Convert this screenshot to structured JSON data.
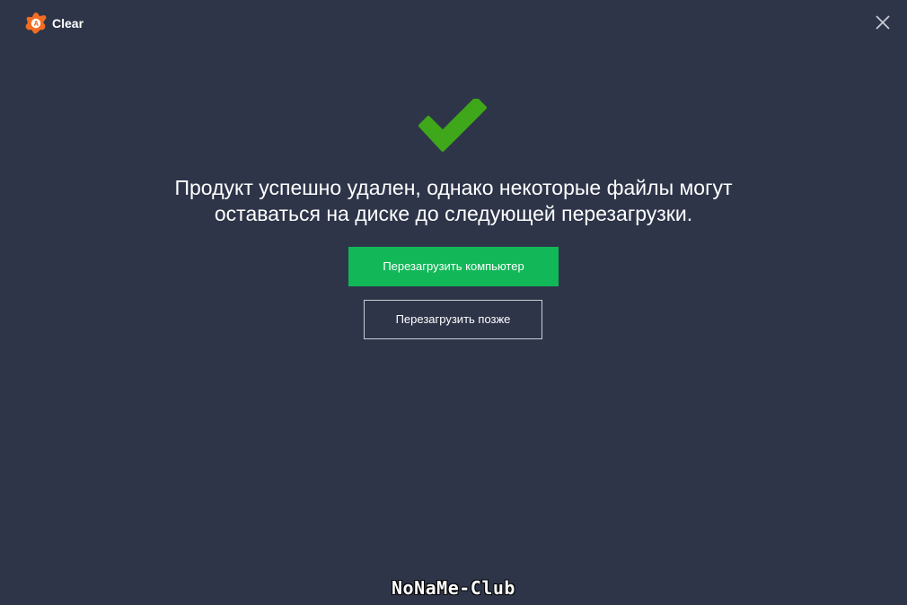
{
  "window": {
    "app_title": "Clear",
    "logo_icon": "avast-logo-icon",
    "close_icon": "close-icon"
  },
  "main": {
    "status_icon": "checkmark-icon",
    "message_line1": "Продукт успешно удален, однако некоторые файлы могут",
    "message_line2": "оставаться на диске до следующей перезагрузки.",
    "restart_now_label": "Перезагрузить компьютер",
    "restart_later_label": "Перезагрузить позже"
  },
  "watermark": {
    "text": "NoNaMe-Club"
  },
  "colors": {
    "background": "#2e3549",
    "accent_green": "#12b758",
    "check_green": "#3fa71a",
    "logo_orange": "#f26d21"
  }
}
